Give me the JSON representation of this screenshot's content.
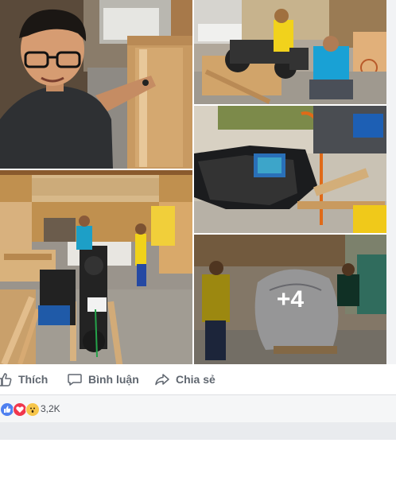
{
  "post": {
    "photos": [
      {
        "name": "photo-selfie-with-crate"
      },
      {
        "name": "photo-workers-with-motorbike"
      },
      {
        "name": "photo-motorbike-fuel-tank"
      },
      {
        "name": "photo-garage-motorbikes"
      },
      {
        "name": "photo-wrapping-motorbike",
        "more_label": "+4"
      }
    ],
    "actions": {
      "like": "Thích",
      "comment": "Bình luận",
      "share": "Chia sẻ"
    },
    "reactions": {
      "types": [
        "like",
        "love",
        "wow"
      ],
      "count": "3,2K"
    }
  },
  "colors": {
    "like_blue": "#4f80f0",
    "love_red": "#f0374d",
    "wow_yellow": "#f7c64b",
    "action_gray": "#606770"
  }
}
